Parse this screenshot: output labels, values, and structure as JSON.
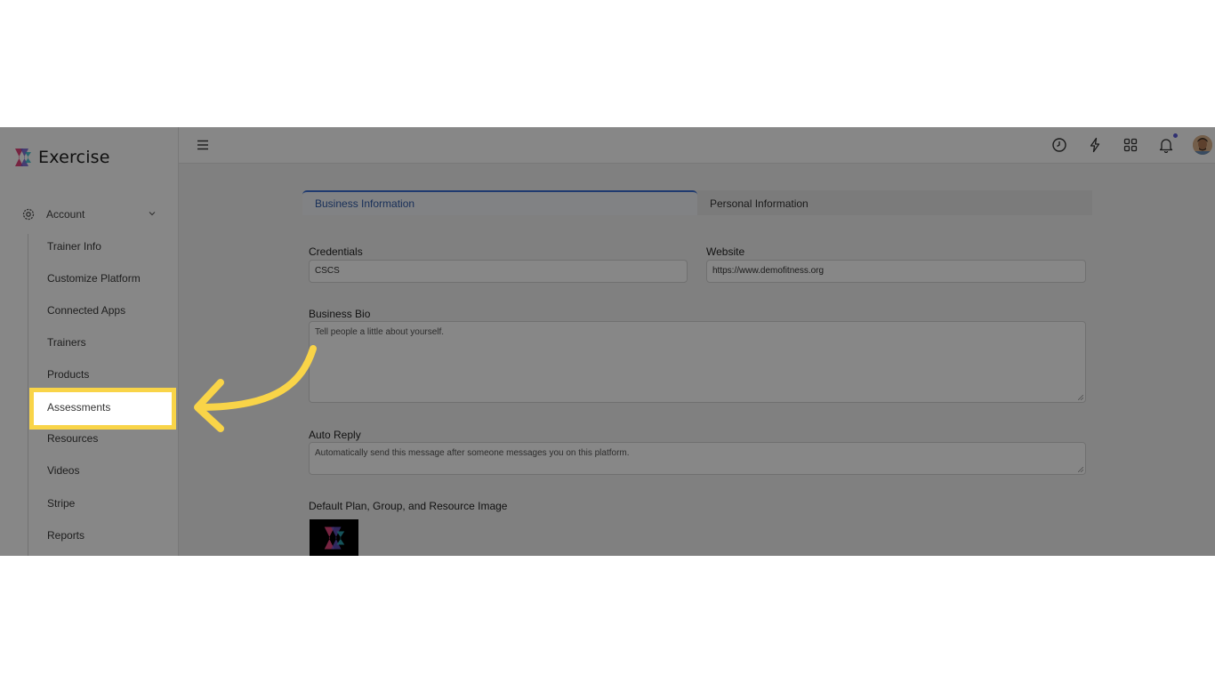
{
  "app": {
    "name": "Exercise"
  },
  "sidebar": {
    "section": "Account",
    "items": [
      {
        "label": "Trainer Info"
      },
      {
        "label": "Customize Platform"
      },
      {
        "label": "Connected Apps"
      },
      {
        "label": "Trainers"
      },
      {
        "label": "Products"
      },
      {
        "label": "Assessments",
        "highlighted": true
      },
      {
        "label": "Resources"
      },
      {
        "label": "Videos"
      },
      {
        "label": "Stripe"
      },
      {
        "label": "Reports"
      }
    ]
  },
  "topbar": {
    "icons": [
      "menu-icon",
      "clock-icon",
      "lightning-icon",
      "apps-grid-icon",
      "bell-icon",
      "avatar"
    ]
  },
  "tabs": [
    {
      "label": "Business Information",
      "active": true
    },
    {
      "label": "Personal Information",
      "active": false
    }
  ],
  "form": {
    "credentials": {
      "label": "Credentials",
      "value": "CSCS"
    },
    "website": {
      "label": "Website",
      "value": "https://www.demofitness.org"
    },
    "business_bio": {
      "label": "Business Bio",
      "placeholder": "Tell people a little about yourself."
    },
    "auto_reply": {
      "label": "Auto Reply",
      "placeholder": "Automatically send this message after someone messages you on this platform."
    },
    "default_image": {
      "label": "Default Plan, Group, and Resource Image"
    }
  },
  "annotation": {
    "highlight_color": "#f9d448",
    "target": "Assessments"
  },
  "colors": {
    "accent": "#3b6fd4",
    "notification_dot": "#5b5bd6",
    "overlay": "rgba(0,0,0,0.47)"
  }
}
